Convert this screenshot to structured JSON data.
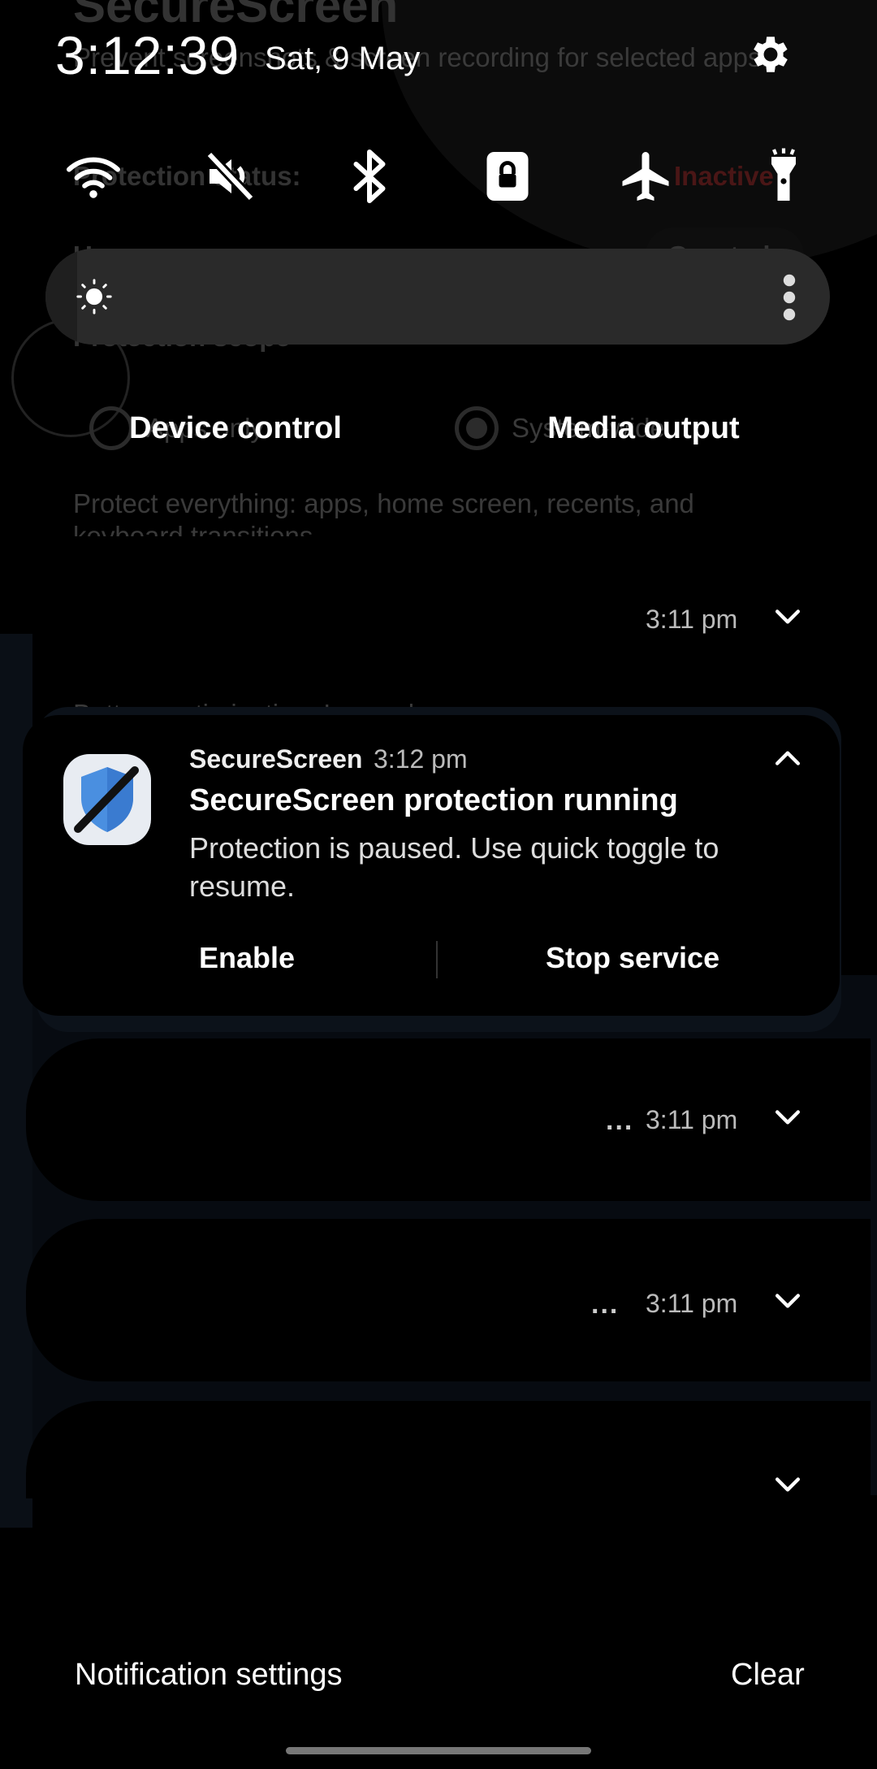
{
  "background_app": {
    "title": "SecureScreen",
    "subtitle": "Prevent screenshots & screen recording for selected apps.",
    "protection_status_label": "Protection status:",
    "protection_status_value": "Inactive",
    "usage_access_label": "Usage access:",
    "usage_access_value": "Granted",
    "protection_scope_label": "Protection scope",
    "scope_option_1": "Apps only",
    "scope_option_2": "System-wide",
    "scope_description": "Protect everything: apps, home screen, recents, and keyboard transitions",
    "battery_label": "Battery optimization: Ignored"
  },
  "header": {
    "clock": "3:12:39",
    "date": "Sat, 9 May"
  },
  "quick_settings": {
    "brightness_level": 0.04,
    "device_control_label": "Device control",
    "media_output_label": "Media output"
  },
  "notifications": {
    "collapsed_top_time": "3:11 pm",
    "expanded": {
      "app_name": "SecureScreen",
      "time": "3:12 pm",
      "title": "SecureScreen protection running",
      "body": "Protection is paused. Use quick toggle to resume.",
      "action_1": "Enable",
      "action_2": "Stop service"
    },
    "stack_1_time": "3:11 pm",
    "stack_1_ellipsis": "...",
    "stack_2_time": "3:11 pm",
    "stack_2_ellipsis": "..."
  },
  "footer": {
    "settings_label": "Notification settings",
    "clear_label": "Clear"
  },
  "colors": {
    "shield_blue": "#4a8fe0",
    "icon_bg": "#e8ecf2"
  }
}
